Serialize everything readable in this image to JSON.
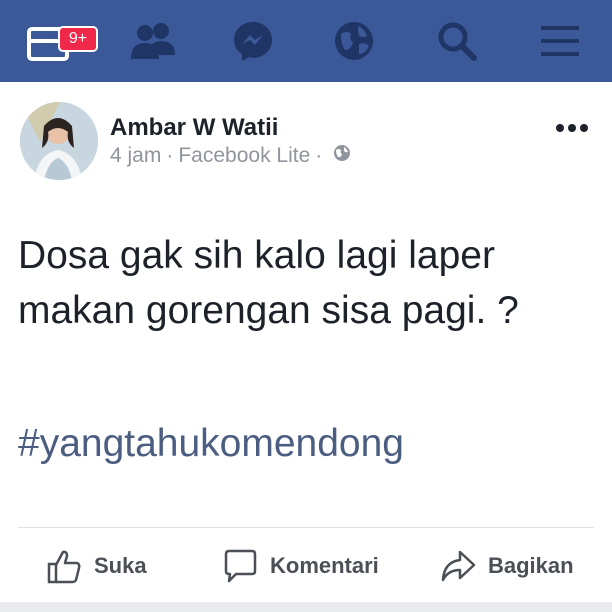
{
  "topbar": {
    "background": "#3b5998",
    "notification_badge": "9+",
    "icons": [
      "notifications-icon",
      "friends-icon",
      "messenger-icon",
      "globe-icon",
      "search-icon",
      "menu-icon"
    ]
  },
  "post": {
    "author_name": "Ambar W Watii",
    "time": "4 jam",
    "source": "Facebook Lite",
    "separator": "·",
    "privacy_icon": "globe-icon",
    "body": "Dosa gak sih kalo lagi laper makan gorengan sisa pagi. ?",
    "hashtag": "#yangtahukomendong",
    "hashtag_color": "#4b5d80"
  },
  "actions": {
    "like_label": "Suka",
    "comment_label": "Komentari",
    "share_label": "Bagikan"
  }
}
